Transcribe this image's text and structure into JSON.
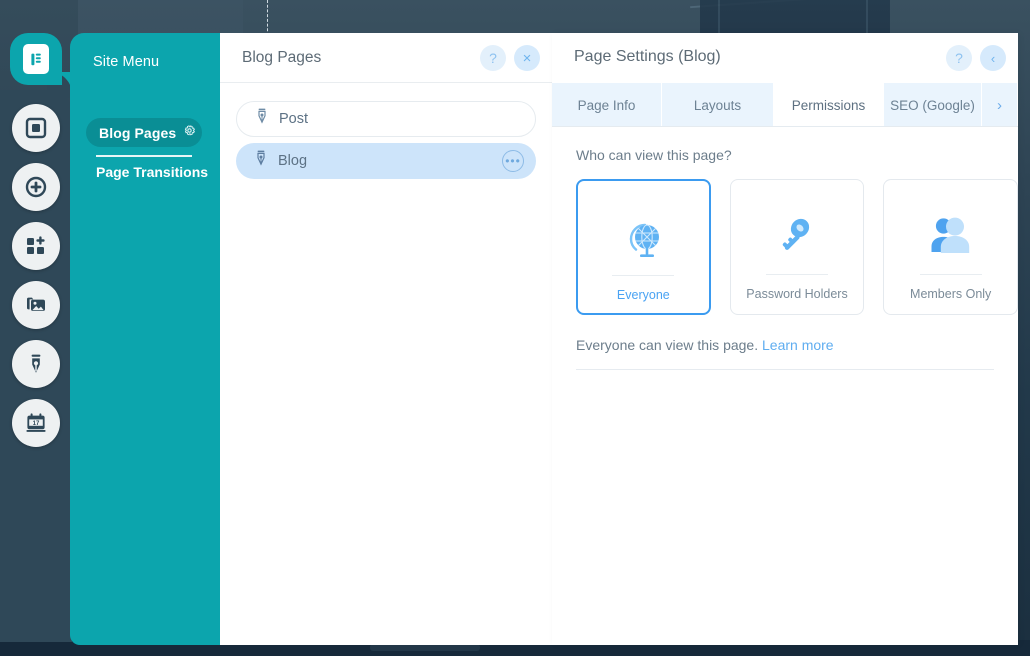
{
  "colors": {
    "teal": "#0CA5AD",
    "teal_dark": "#0A8E95",
    "rail_dark": "#2F4858",
    "accent_blue": "#3B9BF0",
    "link_blue": "#5FADF0",
    "selected_item_bg": "#CDE4FA"
  },
  "rail": {
    "active_tab_icon": "pages-document-icon",
    "buttons": [
      {
        "name": "page-square-icon",
        "label": "Pages"
      },
      {
        "name": "add-plus-icon",
        "label": "Add"
      },
      {
        "name": "add-apps-grid-icon",
        "label": "Add Apps"
      },
      {
        "name": "media-images-icon",
        "label": "Media"
      },
      {
        "name": "design-pen-nib-icon",
        "label": "Design"
      },
      {
        "name": "bookings-calendar-icon",
        "label": "Bookings"
      }
    ]
  },
  "site_menu": {
    "title": "Site Menu",
    "active_item": {
      "label": "Blog Pages",
      "icon": "gear-icon"
    },
    "link": "Page Transitions"
  },
  "blog_pages_panel": {
    "title": "Blog Pages",
    "help_label": "?",
    "close_label": "×",
    "items": [
      {
        "label": "Post",
        "icon": "pen-nib-icon",
        "selected": false
      },
      {
        "label": "Blog",
        "icon": "pen-nib-icon",
        "selected": true,
        "more_label": "•••"
      }
    ]
  },
  "page_settings": {
    "title": "Page Settings (Blog)",
    "help_label": "?",
    "back_label": "‹",
    "tabs": [
      {
        "label": "Page Info",
        "active": false
      },
      {
        "label": "Layouts",
        "active": false
      },
      {
        "label": "Permissions",
        "active": true
      },
      {
        "label": "SEO (Google)",
        "active": false
      }
    ],
    "tabs_scroll_label": "›",
    "question": "Who can view this page?",
    "options": [
      {
        "label": "Everyone",
        "icon": "globe-icon",
        "selected": true
      },
      {
        "label": "Password Holders",
        "icon": "key-icon",
        "selected": false
      },
      {
        "label": "Members Only",
        "icon": "members-people-icon",
        "selected": false
      }
    ],
    "note_text": "Everyone can view this page.",
    "note_link": "Learn more"
  }
}
